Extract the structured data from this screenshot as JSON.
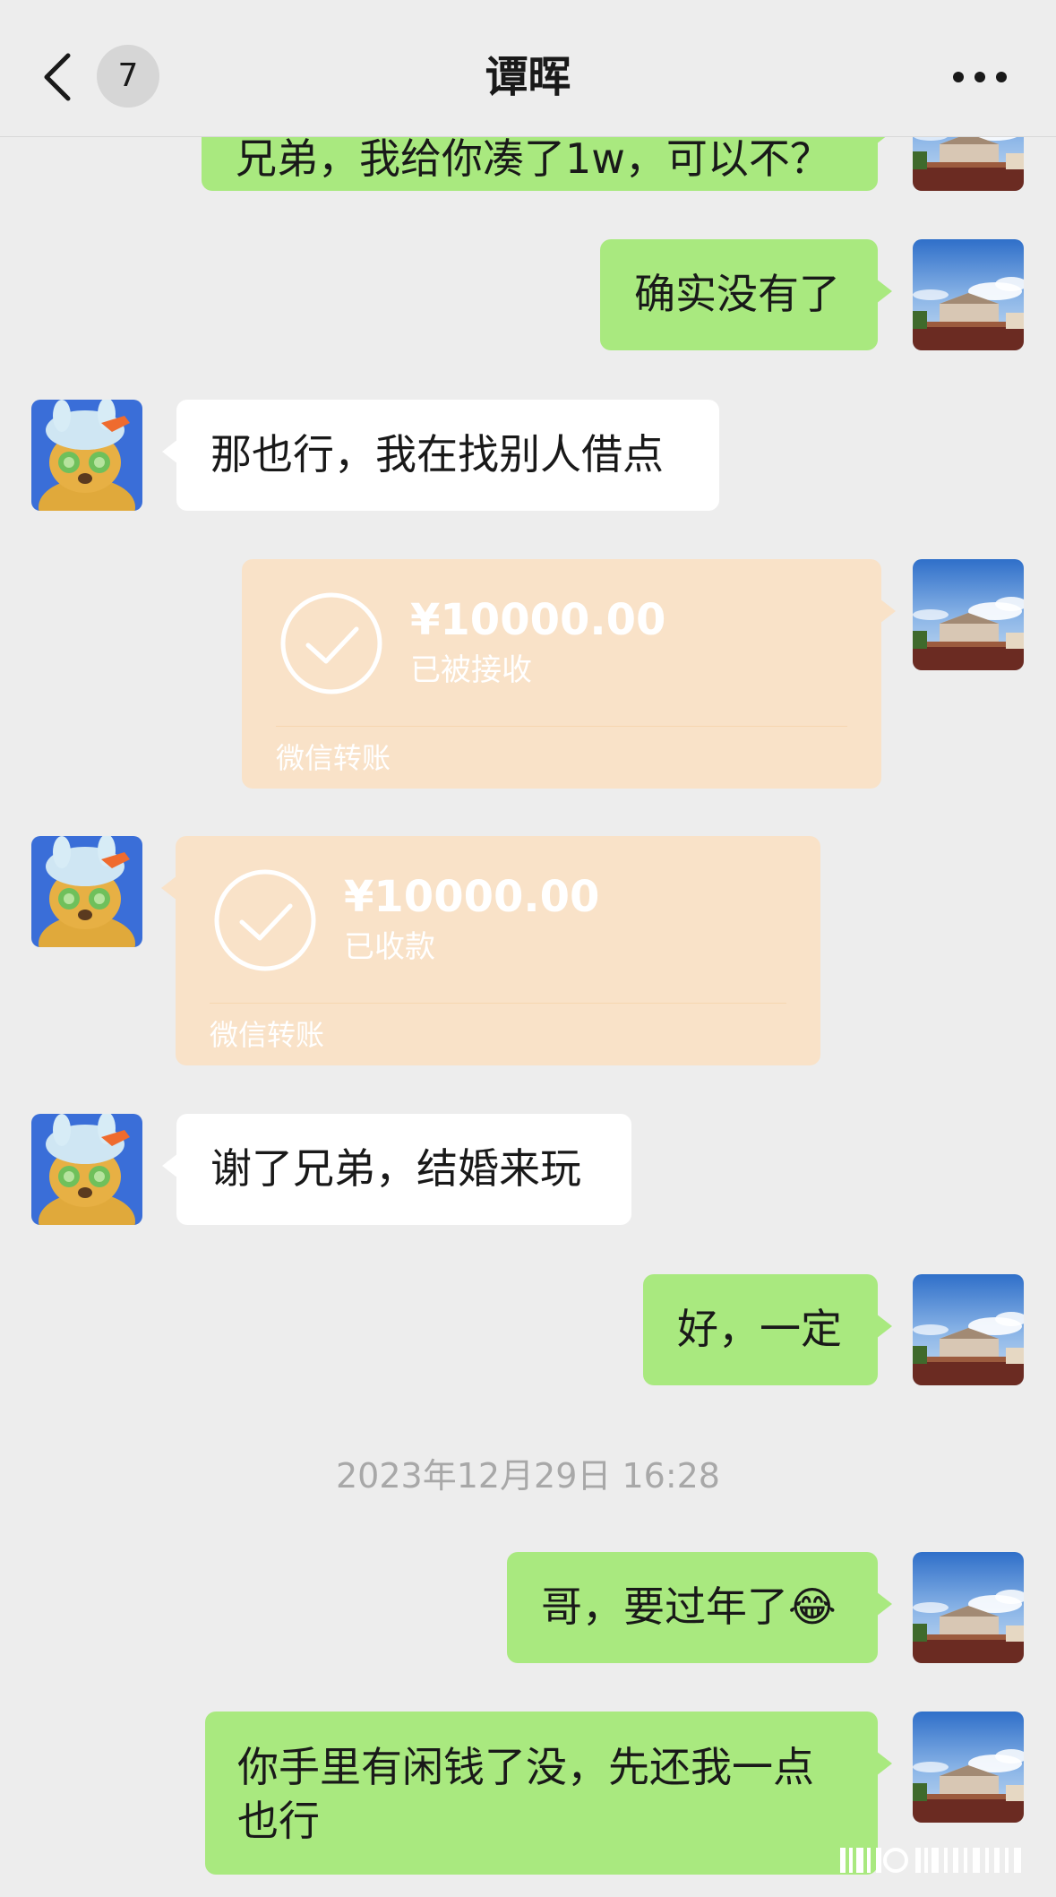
{
  "header": {
    "title": "谭晖",
    "unread_badge": "7",
    "back_icon": "chevron-left-icon",
    "more_icon": "ellipsis-icon"
  },
  "messages": {
    "m0": {
      "sender": "me",
      "text": "兄弟，我给你凑了1w，可以不？"
    },
    "m1": {
      "sender": "me",
      "text": "确实没有了"
    },
    "m2": {
      "sender": "friend",
      "text": "那也行，我在找别人借点"
    },
    "m3": {
      "sender": "me",
      "type": "transfer",
      "amount": "¥10000.00",
      "status": "已被接收",
      "label": "微信转账"
    },
    "m4": {
      "sender": "friend",
      "type": "transfer",
      "amount": "¥10000.00",
      "status": "已收款",
      "label": "微信转账"
    },
    "m5": {
      "sender": "friend",
      "text": "谢了兄弟，结婚来玩"
    },
    "m6": {
      "sender": "me",
      "text": "好，一定"
    },
    "timestamp": "2023年12月29日 16:28",
    "m7": {
      "sender": "me",
      "text": "哥，要过年了",
      "emoji": "😂"
    },
    "m8": {
      "sender": "me",
      "text": "你手里有闲钱了没，先还我一点也行"
    }
  },
  "colors": {
    "background": "#ededed",
    "my_bubble": "#a9e97f",
    "friend_bubble": "#ffffff",
    "transfer_card": "#f9e2c8"
  }
}
